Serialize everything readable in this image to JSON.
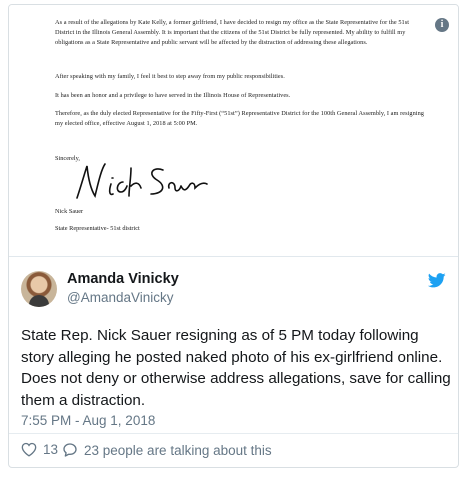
{
  "letter": {
    "paragraphs": [
      "As a result of the allegations by Kate Kelly, a former girlfriend, I have decided to resign my office as the State Representative for the 51st District in the Illinois General Assembly. It is important that the citizens of the 51st District be fully represented. My ability to fulfill my obligations as a State Representative and public servant will be affected by the distraction of addressing these allegations.",
      "After speaking with my family, I feel it best to step away from my public responsibilities.",
      "It has been an honor and a privilege to have served in the Illinois House of Representatives.",
      "Therefore, as the duly elected Representative for the Fifty-First (“51st”) Representative District for the 100th General Assembly, I am resigning my elected office, effective August 1, 2018 at 5:00 PM."
    ],
    "closing": "Sincerely,",
    "signature_text": "Nick Sauer",
    "signer_name": "Nick Sauer",
    "signer_title": "State Representative- 51st district"
  },
  "tweet": {
    "author_name": "Amanda Vinicky",
    "author_handle": "@AmandaVinicky",
    "text": "State Rep. Nick Sauer resigning as of 5 PM today following story alleging he posted naked photo of his ex-girlfriend online. Does not deny or otherwise address allegations, save for calling them a distraction.",
    "timestamp": "7:55 PM - Aug 1, 2018",
    "like_count": "13",
    "talking_label": "23 people are talking about this"
  },
  "icons": {
    "info": "info-icon",
    "brand": "twitter-bird-icon",
    "like": "heart-icon",
    "reply": "speech-bubble-icon"
  },
  "colors": {
    "brand_blue": "#1da1f2",
    "secondary_text": "#657786",
    "primary_text": "#14171a",
    "border": "#d9dfe3"
  }
}
